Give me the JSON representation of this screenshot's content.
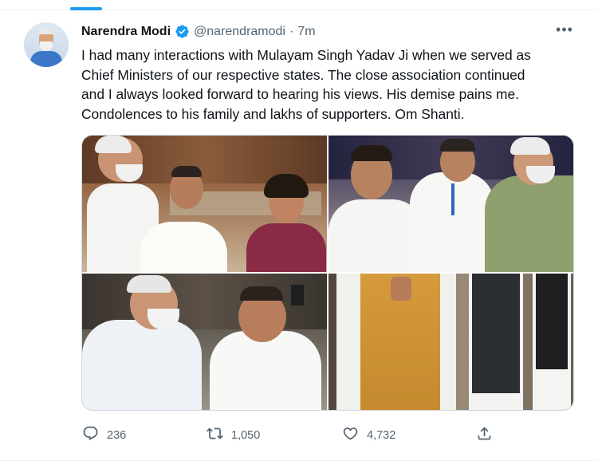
{
  "author": {
    "name": "Narendra Modi",
    "handle": "@narendramodi",
    "separator": "·",
    "time": "7m",
    "verified_color": "#1d9bf0"
  },
  "tweet": {
    "lines": [
      "I had many interactions with Mulayam Singh Yadav Ji when we served as",
      "Chief Ministers of our respective states. The close association continued",
      "and I always looked forward to hearing his views. His demise pains me.",
      "Condolences to his family and lakhs of supporters. Om Shanti."
    ]
  },
  "menu": {
    "more_glyph": "•••"
  },
  "media": {
    "photo_count": 4
  },
  "actions": {
    "replies": "236",
    "retweets": "1,050",
    "likes": "4,732"
  },
  "icons": {
    "reply": "reply-icon",
    "retweet": "retweet-icon",
    "like": "heart-icon",
    "share": "share-icon",
    "verified": "verified-badge-icon",
    "more": "more-options-icon"
  },
  "colors": {
    "accent": "#1d9bf0",
    "text": "#0f1419",
    "secondary": "#536471"
  }
}
